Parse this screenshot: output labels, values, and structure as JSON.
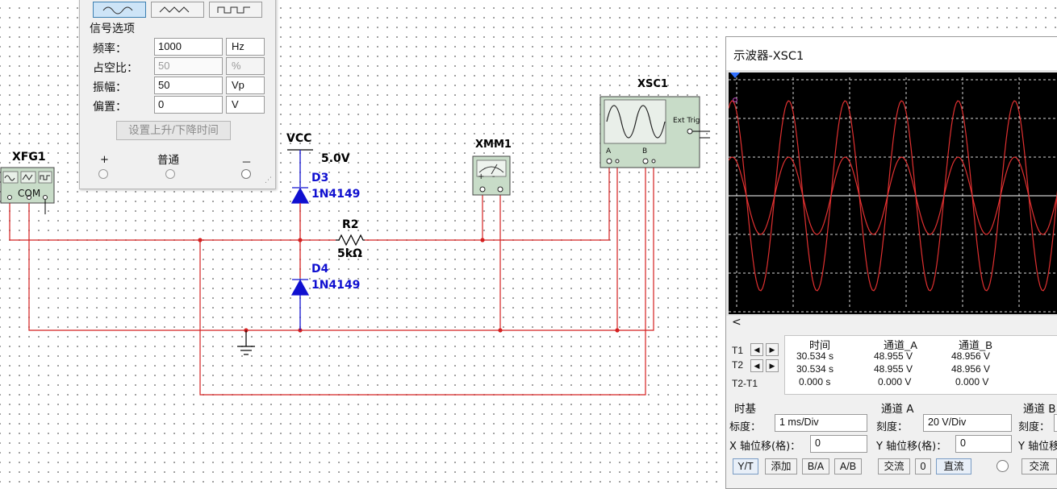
{
  "circuit": {
    "xfg1": {
      "name": "XFG1",
      "com_label": "COM"
    },
    "vcc": {
      "name": "VCC",
      "voltage": "5.0V"
    },
    "d3": {
      "name": "D3",
      "model": "1N4149"
    },
    "d4": {
      "name": "D4",
      "model": "1N4149"
    },
    "r2": {
      "name": "R2",
      "value": "5kΩ"
    },
    "xmm1": {
      "name": "XMM1"
    },
    "xsc1": {
      "name": "XSC1",
      "ext_trig": "Ext Trig",
      "ch_a": "A",
      "ch_b": "B"
    },
    "wire_color": "#d42020",
    "component_color": "#1010d0"
  },
  "function_generator": {
    "section_title": "信号选项",
    "frequency": {
      "label": "频率：",
      "value": "1000",
      "unit": "Hz"
    },
    "duty_cycle": {
      "label": "占空比：",
      "value": "50",
      "unit": "%"
    },
    "amplitude": {
      "label": "振幅：",
      "value": "50",
      "unit": "Vp"
    },
    "offset": {
      "label": "偏置：",
      "value": "0",
      "unit": "V"
    },
    "rise_fall_button": "设置上升/下降时间",
    "terminal_plus": "+",
    "terminal_common": "普通",
    "terminal_minus": "－"
  },
  "oscilloscope": {
    "title": "示波器-XSC1",
    "scroll_left": "<",
    "measurements": {
      "headers": [
        "时间",
        "通道_A",
        "通道_B"
      ],
      "rows": [
        {
          "label": "T1",
          "time": "30.534 s",
          "a": "48.955 V",
          "b": "48.956 V"
        },
        {
          "label": "T2",
          "time": "30.534 s",
          "a": "48.955 V",
          "b": "48.956 V"
        },
        {
          "label": "T2-T1",
          "time": "0.000 s",
          "a": "0.000 V",
          "b": "0.000 V"
        }
      ]
    },
    "timebase": {
      "title": "时基",
      "scale_label": "标度：",
      "scale_value": "1 ms/Div",
      "xpos_label": "X 轴位移(格)：",
      "xpos_value": "0"
    },
    "channel_a": {
      "title": "通道 A",
      "scale_label": "刻度：",
      "scale_value": "20  V/Div",
      "ypos_label": "Y 轴位移(格)：",
      "ypos_value": "0"
    },
    "channel_b": {
      "title": "通道 B",
      "scale_label": "刻度：",
      "ypos_label": "Y 轴位移"
    },
    "buttons": {
      "yt": "Y/T",
      "add": "添加",
      "ba": "B/A",
      "ab": "A/B",
      "ac": "交流",
      "zero": "0",
      "dc": "直流",
      "ac_b": "交流"
    },
    "trace_color": "#e03030",
    "screen_bg": "#000000"
  }
}
